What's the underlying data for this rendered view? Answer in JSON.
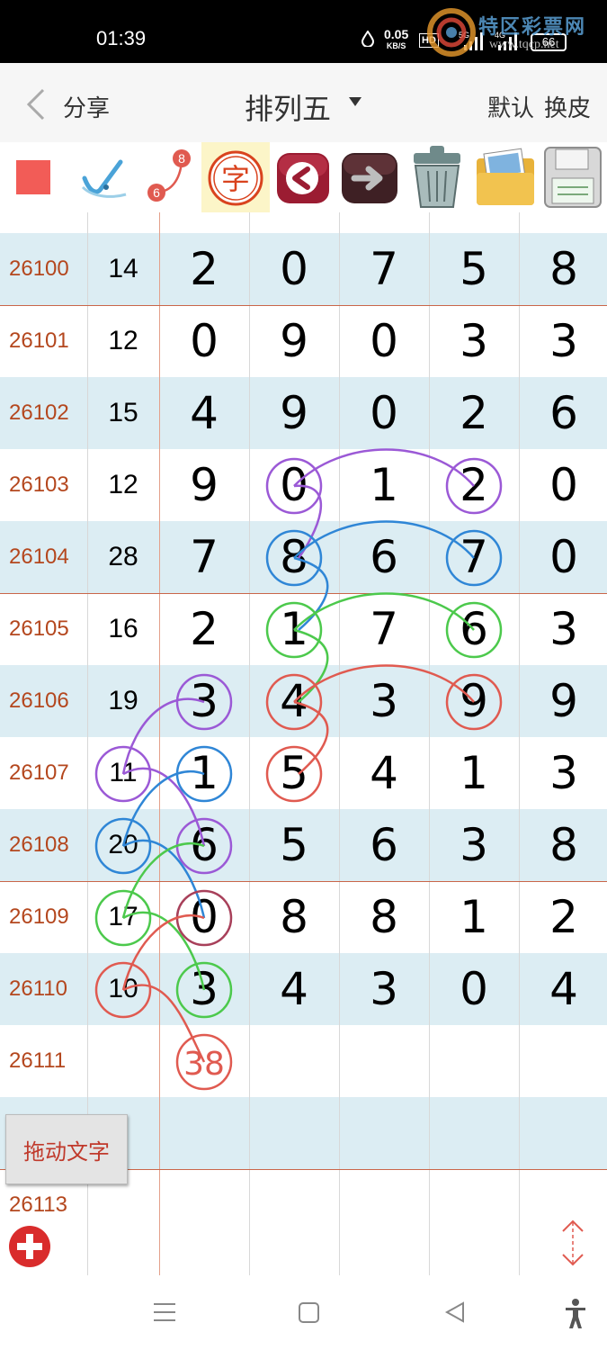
{
  "status_bar": {
    "time": "01:39",
    "net_speed": "0.05",
    "net_unit": "KB/S",
    "hd_label": "HD",
    "sig1": "5G",
    "sig2": "4G",
    "battery": "66"
  },
  "watermark": {
    "title": "特区彩票网",
    "url": "www.tqcp.net"
  },
  "header": {
    "back_icon": "chevron-left-icon",
    "share_label": "分享",
    "title": "排列五",
    "default_label": "默认",
    "skin_label": "换皮"
  },
  "toolbar": {
    "tools": [
      {
        "name": "red-square-color-icon"
      },
      {
        "name": "pen-checkmark-icon"
      },
      {
        "name": "connect-numbers-icon",
        "num_a": "6",
        "num_b": "8"
      },
      {
        "name": "text-char-icon",
        "char": "字"
      },
      {
        "name": "undo-arrow-icon"
      },
      {
        "name": "redo-arrow-icon"
      },
      {
        "name": "trash-icon"
      },
      {
        "name": "images-folder-icon"
      },
      {
        "name": "save-disk-icon"
      }
    ]
  },
  "table": {
    "rows": [
      {
        "issue": "26100",
        "sum": "14",
        "d1": "2",
        "d2": "0",
        "d3": "7",
        "d4": "5",
        "d5": "8"
      },
      {
        "issue": "26101",
        "sum": "12",
        "d1": "0",
        "d2": "9",
        "d3": "0",
        "d4": "3",
        "d5": "3"
      },
      {
        "issue": "26102",
        "sum": "15",
        "d1": "4",
        "d2": "9",
        "d3": "0",
        "d4": "2",
        "d5": "6"
      },
      {
        "issue": "26103",
        "sum": "12",
        "d1": "9",
        "d2": "0",
        "d3": "1",
        "d4": "2",
        "d5": "0"
      },
      {
        "issue": "26104",
        "sum": "28",
        "d1": "7",
        "d2": "8",
        "d3": "6",
        "d4": "7",
        "d5": "0"
      },
      {
        "issue": "26105",
        "sum": "16",
        "d1": "2",
        "d2": "1",
        "d3": "7",
        "d4": "6",
        "d5": "3"
      },
      {
        "issue": "26106",
        "sum": "19",
        "d1": "3",
        "d2": "4",
        "d3": "3",
        "d4": "9",
        "d5": "9"
      },
      {
        "issue": "26107",
        "sum": "11",
        "d1": "1",
        "d2": "5",
        "d3": "4",
        "d4": "1",
        "d5": "3"
      },
      {
        "issue": "26108",
        "sum": "20",
        "d1": "6",
        "d2": "5",
        "d3": "6",
        "d4": "3",
        "d5": "8"
      },
      {
        "issue": "26109",
        "sum": "17",
        "d1": "0",
        "d2": "8",
        "d3": "8",
        "d4": "1",
        "d5": "2"
      },
      {
        "issue": "26110",
        "sum": "10",
        "d1": "3",
        "d2": "4",
        "d3": "3",
        "d4": "0",
        "d5": "4"
      },
      {
        "issue": "26111",
        "sum": "",
        "d1": "",
        "d2": "",
        "d3": "",
        "d4": "",
        "d5": ""
      },
      {
        "issue": "",
        "sum": "",
        "d1": "",
        "d2": "",
        "d3": "",
        "d4": "",
        "d5": ""
      },
      {
        "issue": "26113",
        "sum": "",
        "d1": "",
        "d2": "",
        "d3": "",
        "d4": "",
        "d5": ""
      }
    ],
    "prediction": "38"
  },
  "annotation_colors": {
    "purple": "#9b59d6",
    "blue": "#2f86d6",
    "green": "#4cc94c",
    "red": "#e05a50"
  },
  "floating": {
    "drag_text_label": "拖动文字",
    "add_icon": "plus-circle-icon",
    "scroll_icon": "up-down-arrows-icon"
  },
  "nav_bar": {
    "items": [
      "menu-icon",
      "home-square-icon",
      "back-triangle-icon",
      "accessibility-icon"
    ]
  }
}
